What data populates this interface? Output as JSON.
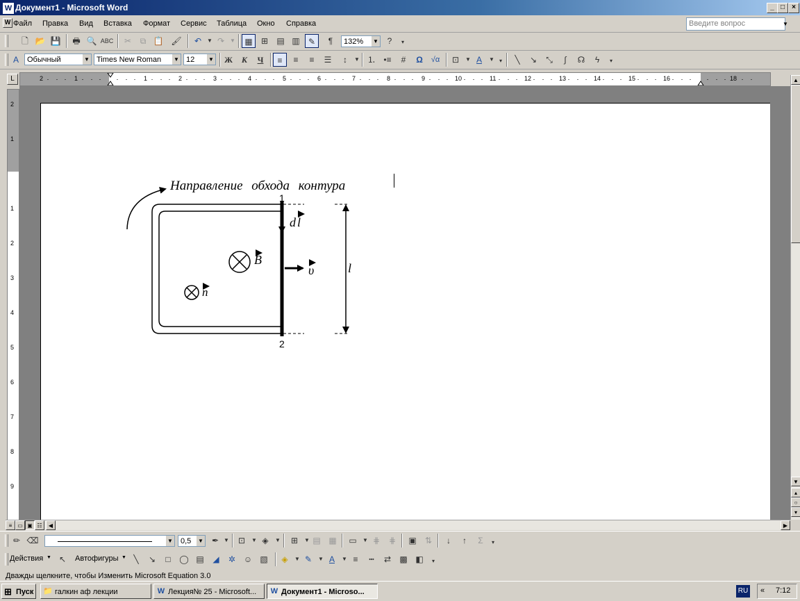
{
  "window": {
    "title": "Документ1 - Microsoft Word",
    "app_icon": "W"
  },
  "menu": {
    "items": [
      "Файл",
      "Правка",
      "Вид",
      "Вставка",
      "Формат",
      "Сервис",
      "Таблица",
      "Окно",
      "Справка"
    ],
    "ask_placeholder": "Введите вопрос"
  },
  "toolbar_standard": {
    "zoom": "132%"
  },
  "toolbar_format": {
    "style": "Обычный",
    "font": "Times New Roman",
    "size": "12",
    "bold": "Ж",
    "italic": "К",
    "underline": "Ч",
    "omega": "Ω",
    "sqrt": "√α"
  },
  "ruler": {
    "numbers": [
      "2",
      "1",
      "1",
      "2",
      "3",
      "4",
      "5",
      "6",
      "7",
      "8",
      "9",
      "10",
      "11",
      "12",
      "13",
      "14",
      "15",
      "16",
      "18"
    ],
    "vnumbers": [
      "2",
      "1",
      "1",
      "2",
      "3",
      "4",
      "5",
      "6",
      "7",
      "8",
      "9"
    ]
  },
  "figure": {
    "caption": "Направление обхода контура",
    "label_1": "1",
    "label_2": "2",
    "dl": "d",
    "B": "B",
    "n": "n",
    "v": "υ",
    "l": "l"
  },
  "drawing_toolbar": {
    "line_width": "0,5",
    "actions": "Действия",
    "autoshapes": "Автофигуры"
  },
  "status": {
    "text": "Дважды щелкните, чтобы Изменить Microsoft Equation 3.0"
  },
  "taskbar": {
    "start": "Пуск",
    "tasks": [
      "галкин аф лекции",
      "Лекция№ 25 - Microsoft...",
      "Документ1 - Microso..."
    ],
    "lang": "RU",
    "clock": "7:12"
  }
}
